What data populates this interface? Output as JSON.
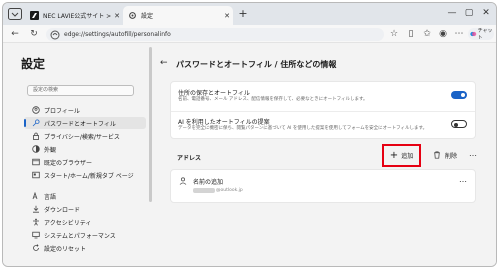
{
  "tabs": [
    {
      "title": "NEC LAVIE公式サイト > サービス＆サ..."
    },
    {
      "title": "設定"
    }
  ],
  "toolbar": {
    "url": "edge://settings/autofill/personalinfo",
    "copilot_label": "チャット"
  },
  "sidebar": {
    "title": "設定",
    "search_placeholder": "設定の検索",
    "items": [
      {
        "label": "プロフィール",
        "icon": "profile-icon"
      },
      {
        "label": "パスワードとオートフィル",
        "icon": "key-icon"
      },
      {
        "label": "プライバシー/検索/サービス",
        "icon": "lock-icon"
      },
      {
        "label": "外観",
        "icon": "appearance-icon"
      },
      {
        "label": "既定のブラウザー",
        "icon": "browser-icon"
      },
      {
        "label": "スタート/ホーム/新規タブ ページ",
        "icon": "home-icon"
      },
      {
        "label": "言語",
        "icon": "language-icon"
      },
      {
        "label": "ダウンロード",
        "icon": "download-icon"
      },
      {
        "label": "アクセシビリティ",
        "icon": "accessibility-icon"
      },
      {
        "label": "システムとパフォーマンス",
        "icon": "system-icon"
      },
      {
        "label": "設定のリセット",
        "icon": "reset-icon"
      }
    ],
    "selected_index": 1
  },
  "main": {
    "heading": "パスワードとオートフィル / 住所などの情報",
    "settings": [
      {
        "title": "住所の保存とオートフィル",
        "description": "名前、電話番号、メール アドレス、配信情報を保存して、必要なときにオートフィルします。",
        "enabled": true
      },
      {
        "title": "AI を利用したオートフィルの提案",
        "description": "データを完全に機密に保ち、閲覧パターンに基づいて AI を使用した提案を使用してフォームを安全にオートフィルします。",
        "enabled": false
      }
    ],
    "address_section": {
      "label": "アドレス",
      "add_label": "追加",
      "delete_label": "削除",
      "more": "…"
    },
    "entry": {
      "name": "名前の追加",
      "email_domain": "@outlook.jp",
      "more": "…"
    }
  },
  "colors": {
    "accent": "#1a63c7",
    "highlight_box": "#e60012"
  }
}
